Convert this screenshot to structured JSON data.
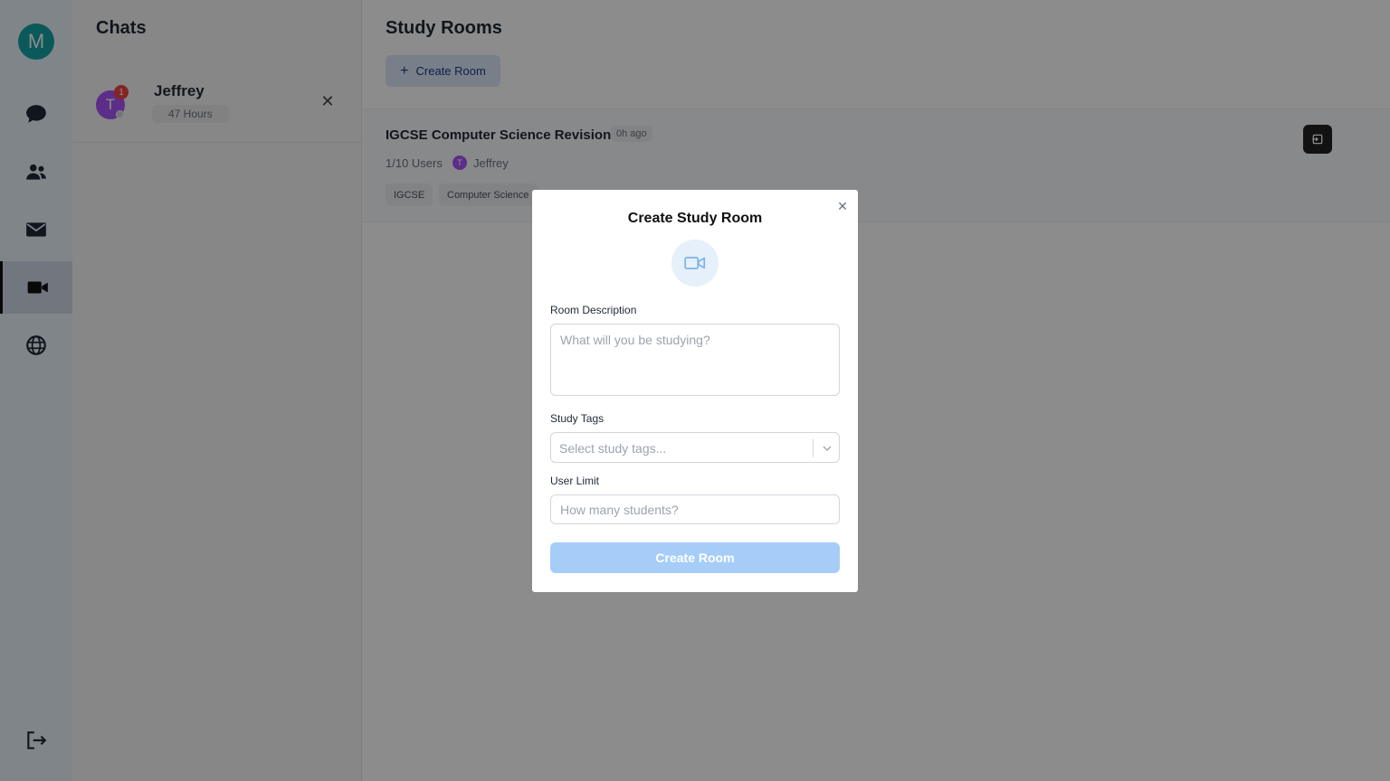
{
  "rail": {
    "avatar_initial": "M",
    "items": [
      {
        "icon": "chat-bubble-icon",
        "active": false
      },
      {
        "icon": "users-icon",
        "active": false
      },
      {
        "icon": "mail-icon",
        "active": false
      },
      {
        "icon": "video-camera-icon",
        "active": true
      },
      {
        "icon": "globe-icon",
        "active": false
      }
    ],
    "logout_icon": "logout-icon"
  },
  "chats": {
    "title": "Chats",
    "items": [
      {
        "name": "Jeffrey",
        "initial": "T",
        "unread": "1",
        "time": "47 Hours"
      }
    ]
  },
  "main": {
    "title": "Study Rooms",
    "create_button": "Create Room",
    "rooms": [
      {
        "title": "IGCSE Computer Science Revision",
        "age": "0h ago",
        "users": "1/10 Users",
        "host_initial": "T",
        "host": "Jeffrey",
        "tags": [
          "IGCSE",
          "Computer Science"
        ]
      }
    ]
  },
  "modal": {
    "title": "Create Study Room",
    "description_label": "Room Description",
    "description_placeholder": "What will you be studying?",
    "tags_label": "Study Tags",
    "tags_placeholder": "Select study tags...",
    "limit_label": "User Limit",
    "limit_placeholder": "How many students?",
    "submit_label": "Create Room"
  },
  "colors": {
    "rail_bg": "#eaf2fc",
    "avatar": "#14a3a5",
    "submit_disabled": "#a6cdf8",
    "badge": "#ef4444",
    "user_avatar": "#a855f7"
  }
}
